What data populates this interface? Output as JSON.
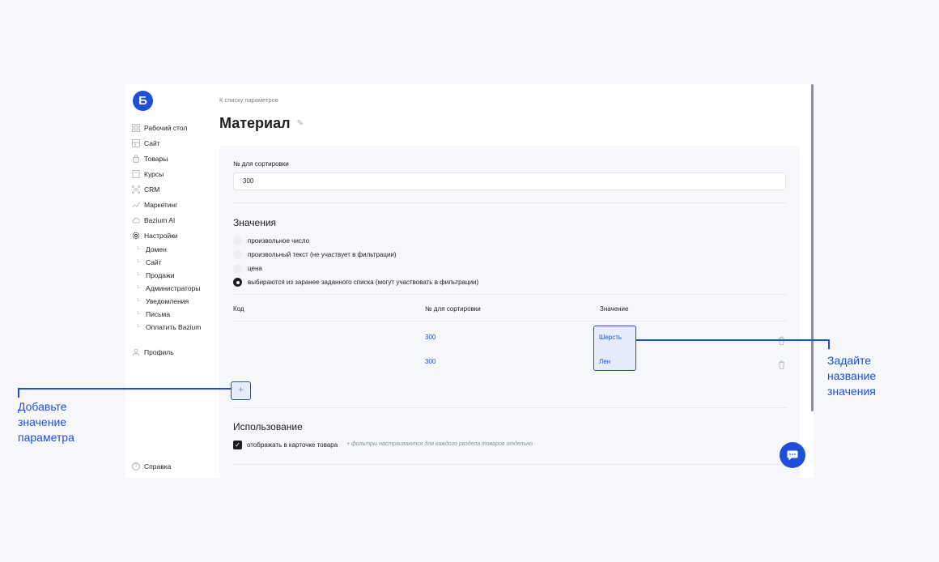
{
  "brand": {
    "logo_letter": "Б",
    "accent": "#1f4fd8"
  },
  "sidebar": {
    "items": [
      {
        "label": "Рабочий стол",
        "icon": "grid-icon"
      },
      {
        "label": "Сайт",
        "icon": "layout-icon"
      },
      {
        "label": "Товары",
        "icon": "bag-icon"
      },
      {
        "label": "Курсы",
        "icon": "book-icon"
      },
      {
        "label": "CRM",
        "icon": "network-icon"
      },
      {
        "label": "Маркетинг",
        "icon": "chart-icon"
      },
      {
        "label": "Bazium AI",
        "icon": "cloud-icon"
      },
      {
        "label": "Настройки",
        "icon": "gear-icon"
      }
    ],
    "subitems": [
      "Домен",
      "Сайт",
      "Продажи",
      "Администраторы",
      "Уведомления",
      "Письма",
      "Оплатить Bazium"
    ],
    "profile": "Профиль",
    "help": "Справка"
  },
  "main": {
    "breadcrumb": "К списку параметров",
    "title": "Материал",
    "sort_label": "№ для сортировки",
    "sort_value": "300",
    "values_title": "Значения",
    "radio_options": [
      {
        "label": "произвольное число",
        "selected": false
      },
      {
        "label": "произвольный текст (не участвует в фильтрации)",
        "selected": false
      },
      {
        "label": "цена",
        "selected": false
      },
      {
        "label": "выбираются из заранее заданного списка (могут участвовать в фильтрации)",
        "selected": true
      }
    ],
    "table": {
      "headers": [
        "Код",
        "№ для сортировки",
        "Значение"
      ],
      "rows": [
        {
          "code": "",
          "sort": "300",
          "value": "Шерсть"
        },
        {
          "code": "",
          "sort": "300",
          "value": "Лен"
        }
      ]
    },
    "add_button": "+",
    "usage_title": "Использование",
    "usage_checkbox": {
      "label": "отображать в карточке товара",
      "checked": true
    },
    "usage_hint": "+ фильтры настраиваются для каждого раздела товаров отдельно"
  },
  "annotations": {
    "left": [
      "Добавьте",
      "значение",
      "параметра"
    ],
    "right": [
      "Задайте",
      "название",
      "значения"
    ]
  }
}
